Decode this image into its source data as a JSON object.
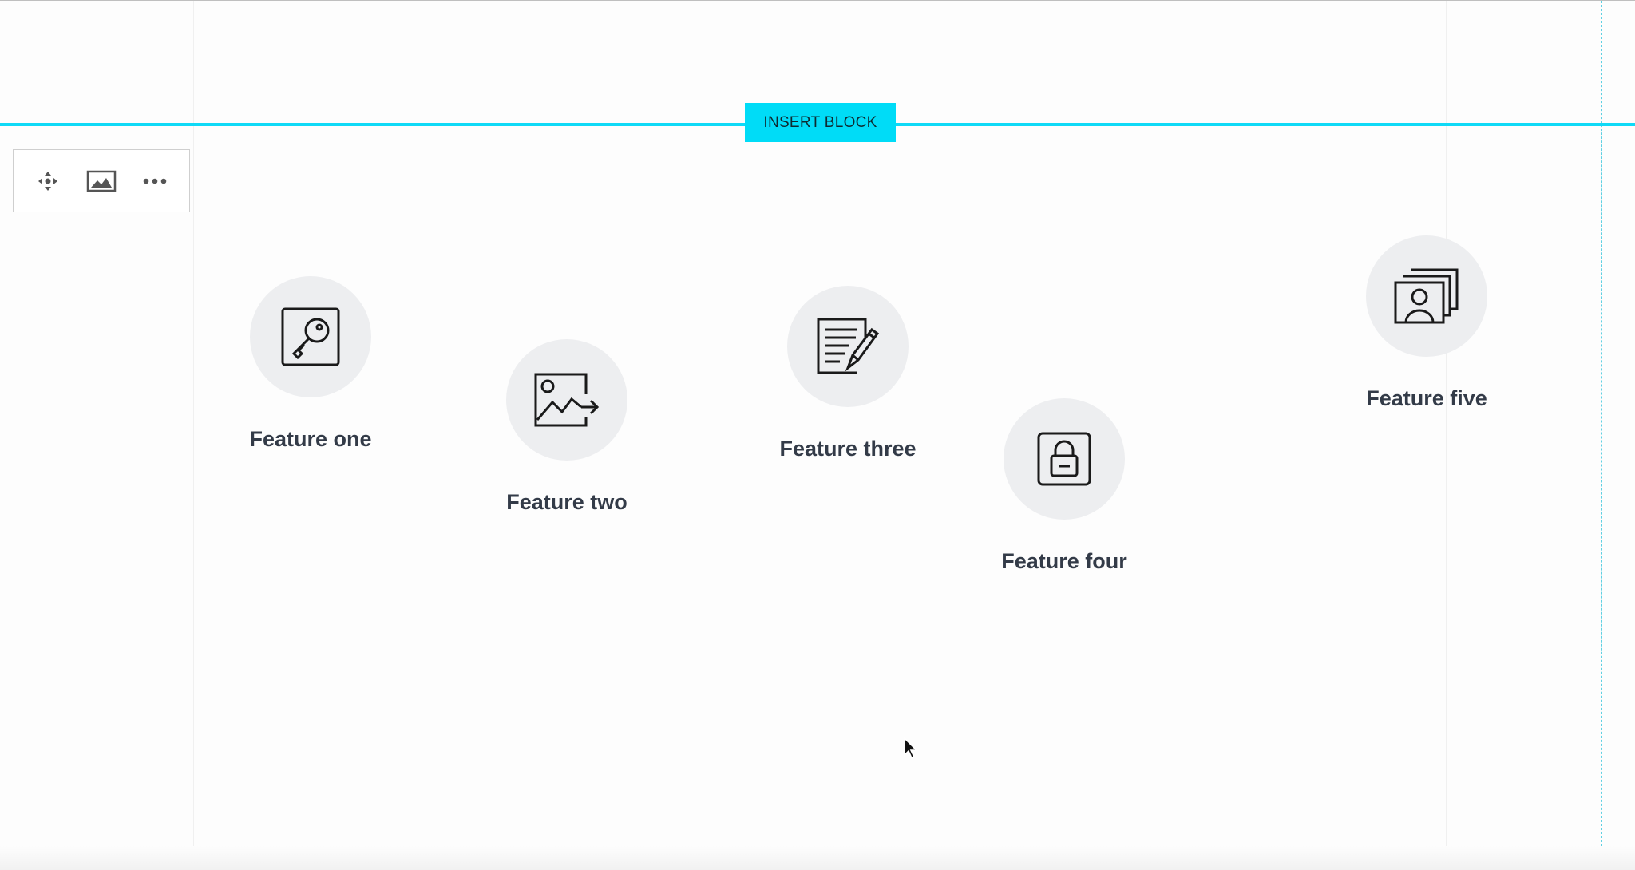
{
  "insert_block": {
    "label": "INSERT BLOCK"
  },
  "toolbar": {
    "items": [
      {
        "icon": "move-icon"
      },
      {
        "icon": "image-icon"
      },
      {
        "icon": "more-icon"
      }
    ]
  },
  "features": [
    {
      "label": "Feature one",
      "icon": "key-icon"
    },
    {
      "label": "Feature two",
      "icon": "image-export-icon"
    },
    {
      "label": "Feature three",
      "icon": "edit-document-icon"
    },
    {
      "label": "Feature four",
      "icon": "lock-icon"
    },
    {
      "label": "Feature five",
      "icon": "user-cards-icon"
    }
  ],
  "colors": {
    "accent": "#00dcf7",
    "icon_circle": "#edeef0",
    "label_text": "#333b48"
  }
}
